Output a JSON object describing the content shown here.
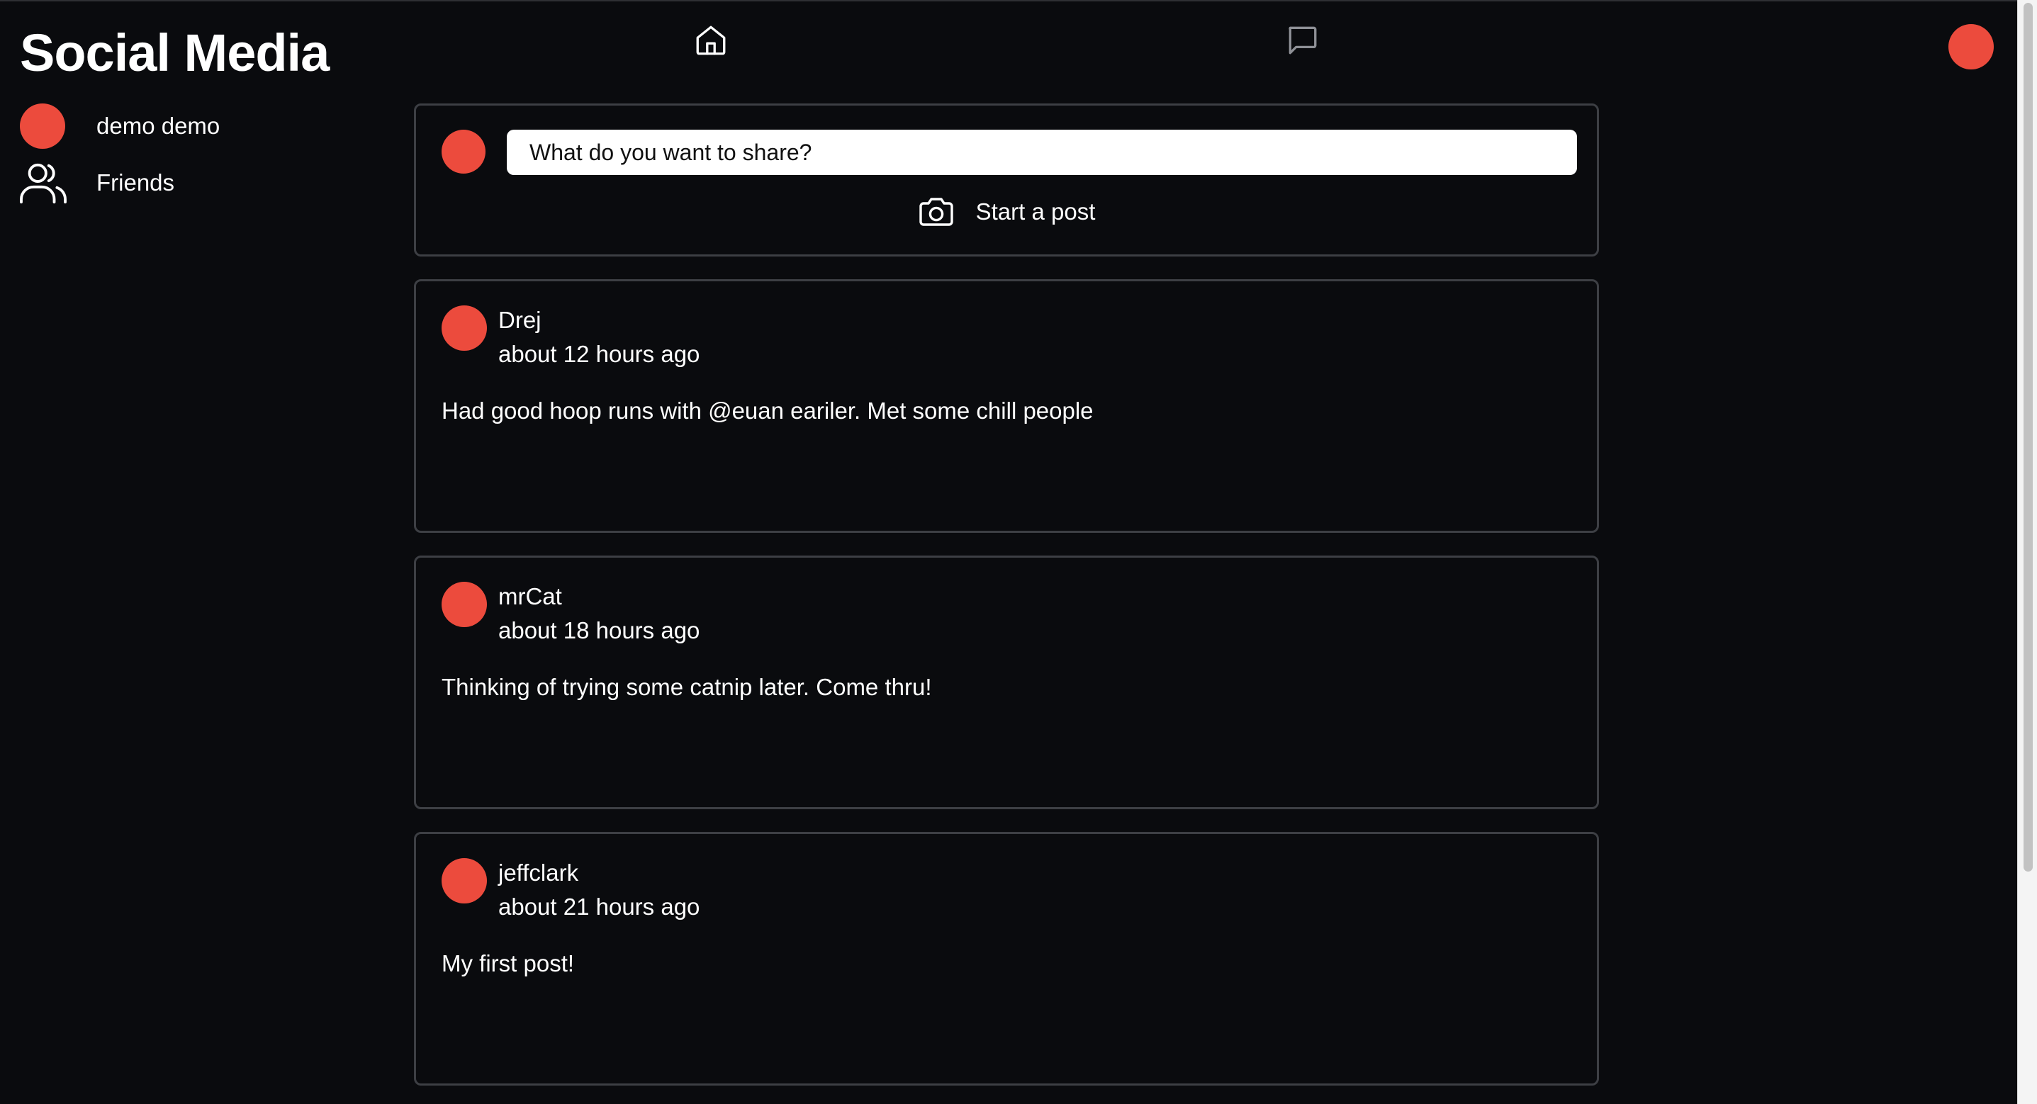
{
  "header": {
    "title": "Social Media",
    "icons": {
      "home": "home-icon",
      "messages": "chat-bubble-icon",
      "profile": "avatar"
    }
  },
  "sidebar": {
    "items": [
      {
        "label": "demo demo",
        "icon": "avatar"
      },
      {
        "label": "Friends",
        "icon": "users-icon"
      }
    ]
  },
  "composer": {
    "placeholder": "What do you want to share?",
    "start_post_label": "Start a post",
    "icon": "camera-icon"
  },
  "posts": [
    {
      "author": "Drej",
      "time": "about 12 hours ago",
      "body": "Had good hoop runs with @euan eariler. Met some chill people"
    },
    {
      "author": "mrCat",
      "time": "about 18 hours ago",
      "body": "Thinking of trying some catnip later. Come thru!"
    },
    {
      "author": "jeffclark",
      "time": "about 21 hours ago",
      "body": "My first post!"
    }
  ],
  "colors": {
    "background": "#0a0b0e",
    "avatar": "#ec4b3d",
    "card_border": "#3d3f44",
    "text": "#ffffff"
  }
}
